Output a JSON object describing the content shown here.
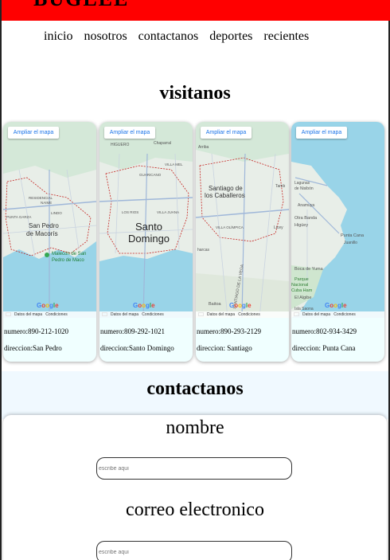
{
  "brand": {
    "name": "BUGLEE"
  },
  "nav": {
    "items": [
      {
        "label": "inicio"
      },
      {
        "label": "nosotros"
      },
      {
        "label": "contactanos"
      },
      {
        "label": "deportes"
      },
      {
        "label": "recientes"
      }
    ]
  },
  "visit": {
    "title": "visitanos",
    "cards": [
      {
        "map_button": "Ampliar el mapa",
        "map_labels": [
          "RESIDENCIAL",
          "NAIME",
          "LINDO",
          "PUNTA GARZA",
          "San Pedro",
          "de Macorís",
          "Malecón de San",
          "Pedro de Maco"
        ],
        "attribution": [
          "Datos del mapa",
          "Condiciones"
        ],
        "numero": "numero:890-212-1020",
        "direccion": "direccion:San Pedro"
      },
      {
        "map_button": "Ampliar el mapa",
        "map_labels": [
          "HIGUERO",
          "Chaparral",
          "VILLA MEL",
          "GUARICANO",
          "LOS RIOS",
          "VILLA JUANA",
          "Santo",
          "Domingo"
        ],
        "attribution": [
          "Datos del mapa",
          "Condiciones"
        ],
        "numero": "numero:809-292-1021",
        "direccion": "direccion:Santo Domingo"
      },
      {
        "map_button": "Ampliar el mapa",
        "map_labels": [
          "Arriba",
          "Tamb",
          "Santiago de",
          "los Caballeros",
          "VILLA OLÍMPICA",
          "Licey",
          "harcas",
          "Baitoa",
          "SANTIAGO DE LA VEGA"
        ],
        "attribution": [
          "Datos del mapa",
          "Condiciones"
        ],
        "numero": "numero:890-293-2129",
        "direccion": "direccion: Santiago"
      },
      {
        "map_button": "Ampliar el mapa",
        "map_labels": [
          "Lagunas",
          "de Nisibón",
          "Anamuya",
          "Otra Banda",
          "Higüey",
          "Punta Cana",
          "Juanillo",
          "Boca de Yuma",
          "Parque",
          "Nacional",
          "Cuba Ham",
          "El Algibe",
          "Isla Saona"
        ],
        "attribution": [
          "Datos del mapa",
          "Condiciones"
        ],
        "numero": "numero:802-934-3429",
        "direccion": "direccion: Punta Cana"
      }
    ],
    "map_logo": "Google"
  },
  "contact": {
    "title": "contactanos",
    "name_label": "nombre",
    "name_placeholder": "escribe aqui",
    "email_label": "correo electronico",
    "email_placeholder": "escribe aqui"
  },
  "colors": {
    "topbar": "#ff0000",
    "card_bg": "#f0ffff",
    "sea": "#99d4e8",
    "land": "#e8eee8",
    "link": "#1a73e8"
  }
}
